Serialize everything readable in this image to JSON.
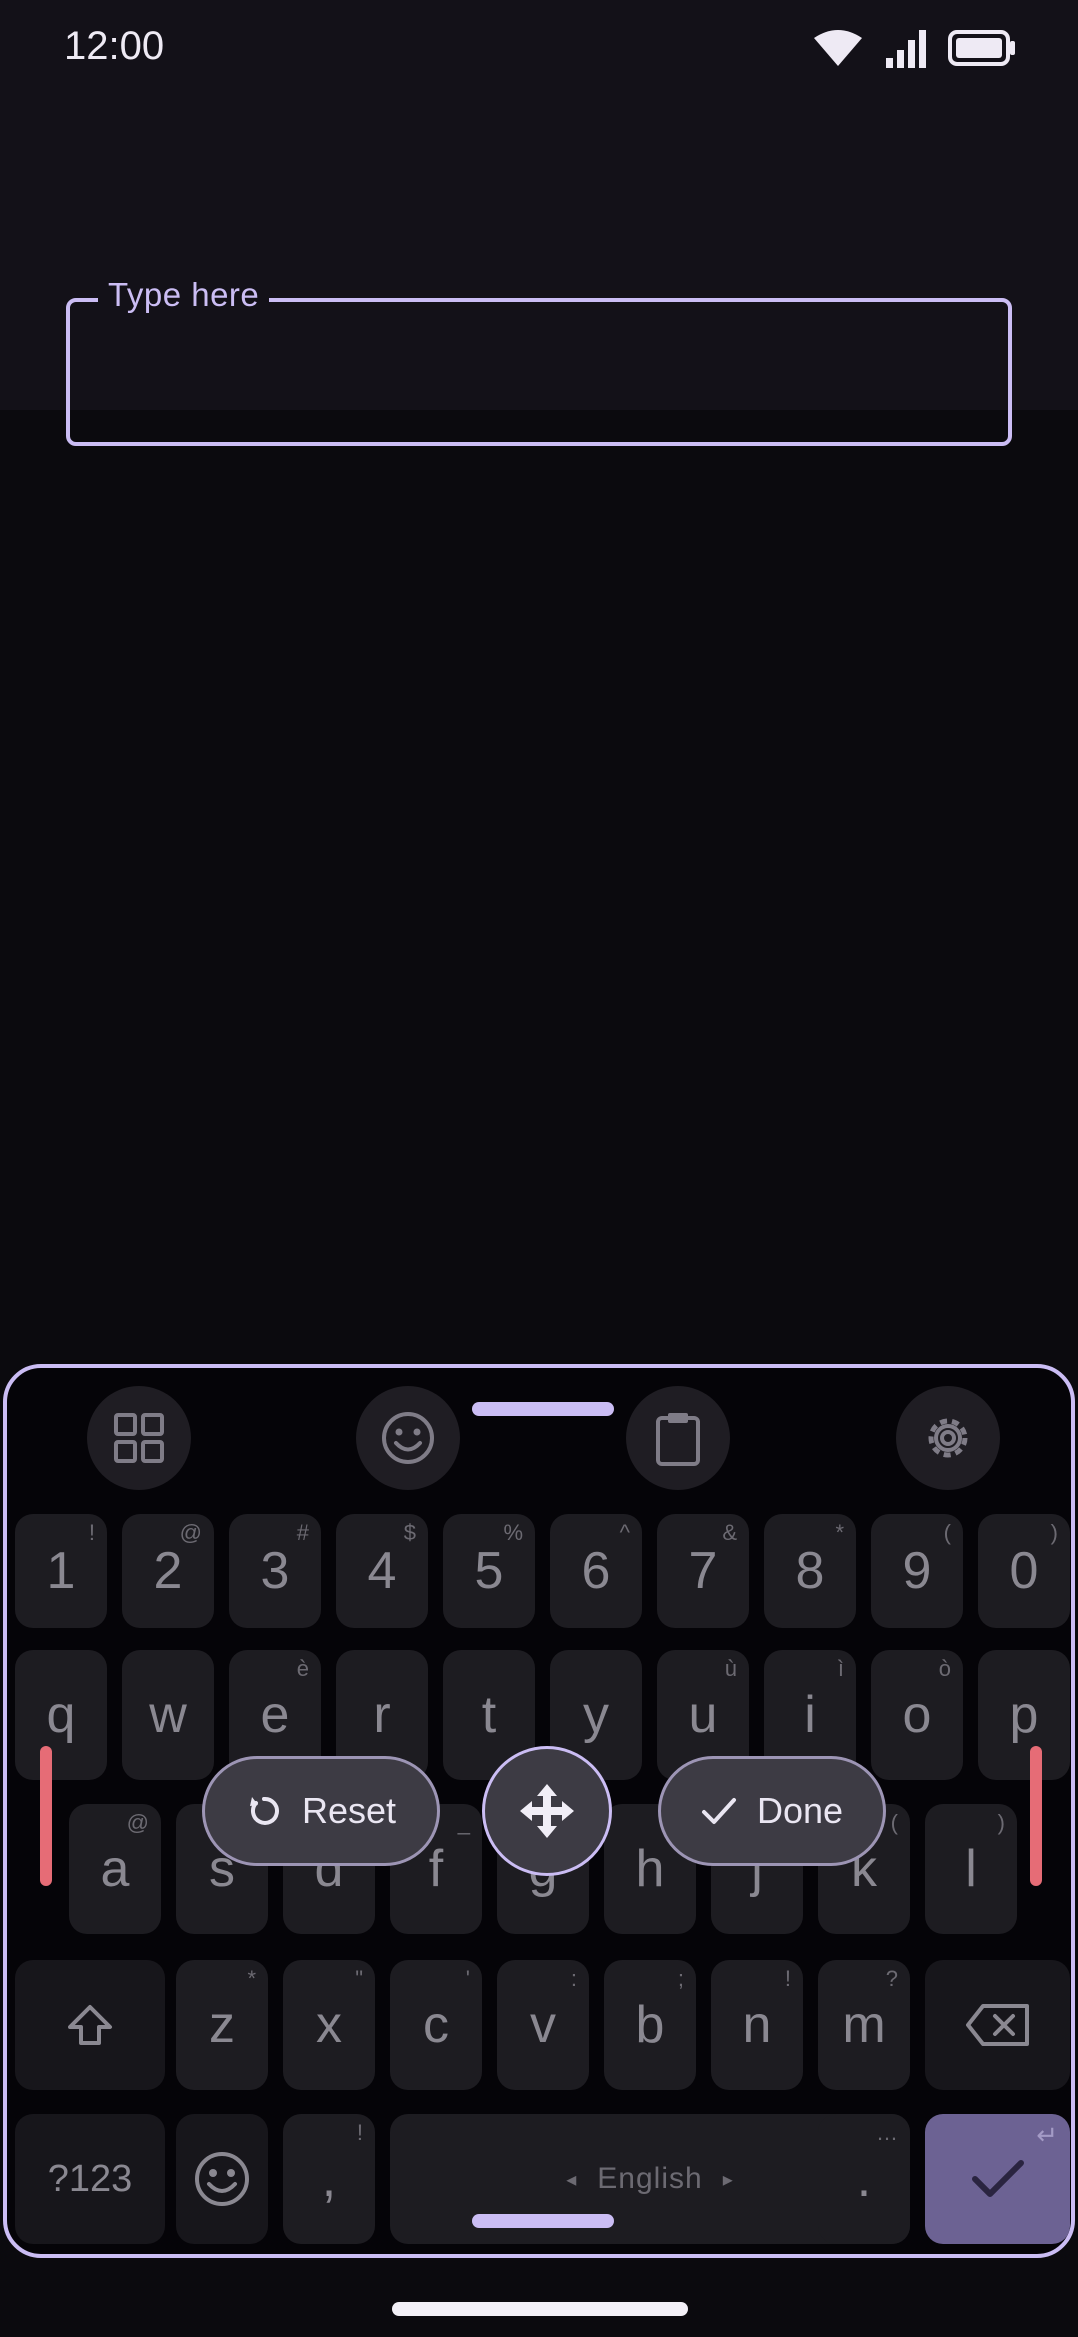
{
  "status_bar": {
    "time": "12:00"
  },
  "text_field": {
    "label": "Type here",
    "value": ""
  },
  "toolbar": {
    "buttons": [
      {
        "name": "apps-grid-icon"
      },
      {
        "name": "emoji-icon"
      },
      {
        "name": "clipboard-icon"
      },
      {
        "name": "settings-gear-icon"
      }
    ]
  },
  "keyboard": {
    "number_row": [
      {
        "key": "1",
        "hint": "!"
      },
      {
        "key": "2",
        "hint": "@"
      },
      {
        "key": "3",
        "hint": "#"
      },
      {
        "key": "4",
        "hint": "$"
      },
      {
        "key": "5",
        "hint": "%"
      },
      {
        "key": "6",
        "hint": "^"
      },
      {
        "key": "7",
        "hint": "&"
      },
      {
        "key": "8",
        "hint": "*"
      },
      {
        "key": "9",
        "hint": "("
      },
      {
        "key": "0",
        "hint": ")"
      }
    ],
    "row1": [
      {
        "key": "q",
        "hint": ""
      },
      {
        "key": "w",
        "hint": ""
      },
      {
        "key": "e",
        "hint": "è"
      },
      {
        "key": "r",
        "hint": ""
      },
      {
        "key": "t",
        "hint": ""
      },
      {
        "key": "y",
        "hint": ""
      },
      {
        "key": "u",
        "hint": "ù"
      },
      {
        "key": "i",
        "hint": "ì"
      },
      {
        "key": "o",
        "hint": "ò"
      },
      {
        "key": "p",
        "hint": ""
      }
    ],
    "row2": [
      {
        "key": "a",
        "hint": "@"
      },
      {
        "key": "s",
        "hint": ""
      },
      {
        "key": "d",
        "hint": ""
      },
      {
        "key": "f",
        "hint": "_"
      },
      {
        "key": "g",
        "hint": ""
      },
      {
        "key": "h",
        "hint": ""
      },
      {
        "key": "j",
        "hint": ""
      },
      {
        "key": "k",
        "hint": "("
      },
      {
        "key": "l",
        "hint": ")"
      }
    ],
    "row3": [
      {
        "key": "z",
        "hint": "*"
      },
      {
        "key": "x",
        "hint": "\""
      },
      {
        "key": "c",
        "hint": "'"
      },
      {
        "key": "v",
        "hint": ":"
      },
      {
        "key": "b",
        "hint": ";"
      },
      {
        "key": "n",
        "hint": "!"
      },
      {
        "key": "m",
        "hint": "?"
      }
    ],
    "symbols_label": "?123",
    "comma": {
      "key": ",",
      "hint": "!"
    },
    "space_label": "English",
    "space_left_arrow": "◂",
    "space_right_arrow": "▸",
    "period": {
      "key": ".",
      "hint": "…"
    },
    "enter_hint": "↵"
  },
  "resize_overlay": {
    "reset_label": "Reset",
    "done_label": "Done"
  },
  "colors": {
    "accent": "#cbbdf4",
    "key_bg": "#1d1c21",
    "edge_marker": "#e66c76",
    "enter_key": "#6c6293"
  }
}
